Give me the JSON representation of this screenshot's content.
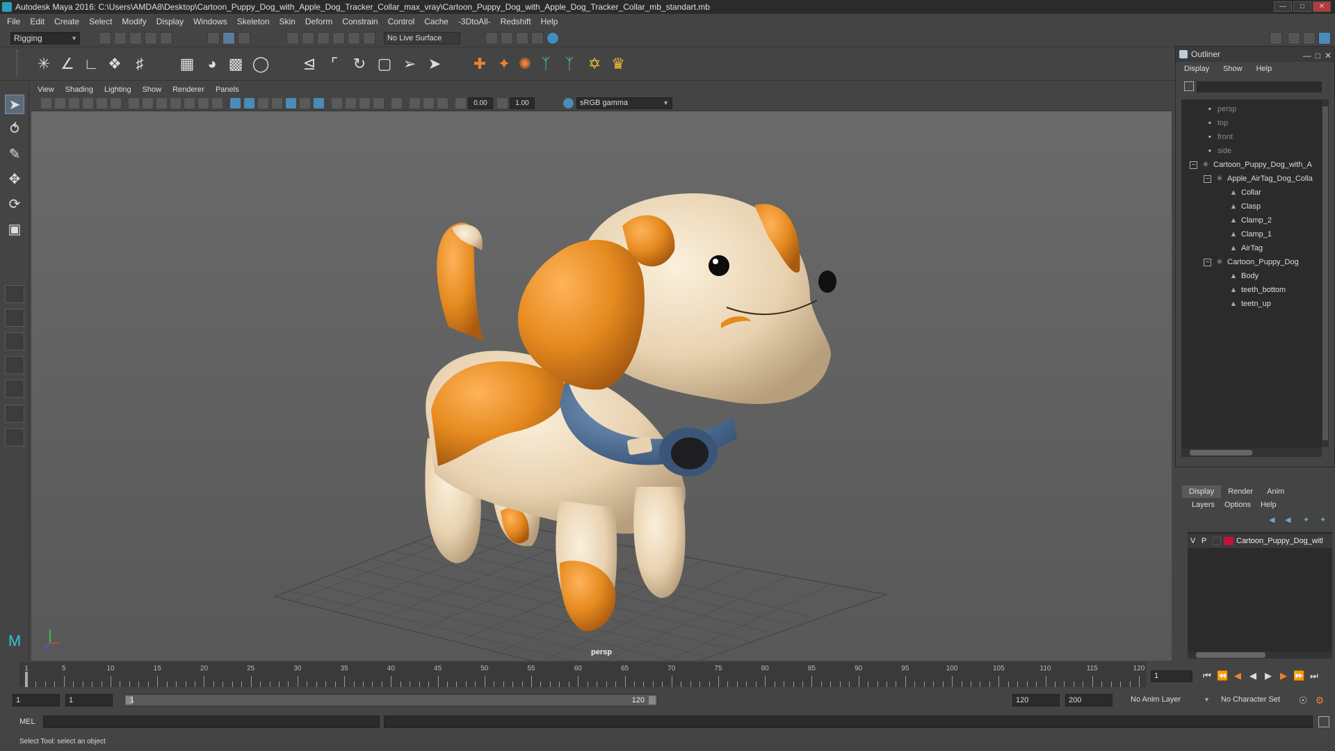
{
  "title_bar": {
    "text": "Autodesk Maya 2016: C:\\Users\\AMDA8\\Desktop\\Cartoon_Puppy_Dog_with_Apple_Dog_Tracker_Collar_max_vray\\Cartoon_Puppy_Dog_with_Apple_Dog_Tracker_Collar_mb_standart.mb"
  },
  "menu": [
    "File",
    "Edit",
    "Create",
    "Select",
    "Modify",
    "Display",
    "Windows",
    "Skeleton",
    "Skin",
    "Deform",
    "Constrain",
    "Control",
    "Cache",
    "-3DtoAll-",
    "Redshift",
    "Help"
  ],
  "status_line": {
    "mode": "Rigging",
    "live_surface": "No Live Surface"
  },
  "viewport": {
    "menu": [
      "View",
      "Shading",
      "Lighting",
      "Show",
      "Renderer",
      "Panels"
    ],
    "exposure": "0.00",
    "gamma": "1.00",
    "color_space": "sRGB gamma",
    "camera_label": "persp"
  },
  "outliner": {
    "title": "Outliner",
    "menu": [
      "Display",
      "Show",
      "Help"
    ],
    "items": [
      {
        "label": "persp",
        "type": "camera"
      },
      {
        "label": "top",
        "type": "camera"
      },
      {
        "label": "front",
        "type": "camera"
      },
      {
        "label": "side",
        "type": "camera"
      },
      {
        "label": "Cartoon_Puppy_Dog_with_A",
        "type": "group"
      },
      {
        "label": "Apple_AirTag_Dog_Colla",
        "type": "group"
      },
      {
        "label": "Collar",
        "type": "mesh"
      },
      {
        "label": "Clasp",
        "type": "mesh"
      },
      {
        "label": "Clamp_2",
        "type": "mesh"
      },
      {
        "label": "Clamp_1",
        "type": "mesh"
      },
      {
        "label": "AirTag",
        "type": "mesh"
      },
      {
        "label": "Cartoon_Puppy_Dog",
        "type": "group"
      },
      {
        "label": "Body",
        "type": "mesh"
      },
      {
        "label": "teeth_bottom",
        "type": "mesh"
      },
      {
        "label": "teetn_up",
        "type": "mesh"
      }
    ]
  },
  "layer_editor": {
    "tabs": [
      "Display",
      "Render",
      "Anim"
    ],
    "active_tab": "Display",
    "menu": [
      "Layers",
      "Options",
      "Help"
    ],
    "layer": {
      "v": "V",
      "p": "P",
      "name": "Cartoon_Puppy_Dog_witl",
      "color": "#c0143c"
    }
  },
  "time_slider": {
    "ticks": [
      "1",
      "5",
      "10",
      "15",
      "20",
      "25",
      "30",
      "35",
      "40",
      "45",
      "50",
      "55",
      "60",
      "65",
      "70",
      "75",
      "80",
      "85",
      "90",
      "95",
      "100",
      "105",
      "110",
      "115",
      "120"
    ],
    "current_frame": "1"
  },
  "range_slider": {
    "start": "1",
    "playback_start": "1",
    "range_start": "1",
    "range_end": "120",
    "playback_end": "120",
    "end": "200",
    "anim_layer": "No Anim Layer",
    "character_set": "No Character Set"
  },
  "command_line": {
    "label": "MEL"
  },
  "help_line": {
    "text": "Select Tool: select an object"
  },
  "colors": {
    "dog_orange": "#e58a1f",
    "dog_cream": "#e8d2b0",
    "collar_blue": "#4b6f96",
    "accent": "#4b8bb8"
  }
}
